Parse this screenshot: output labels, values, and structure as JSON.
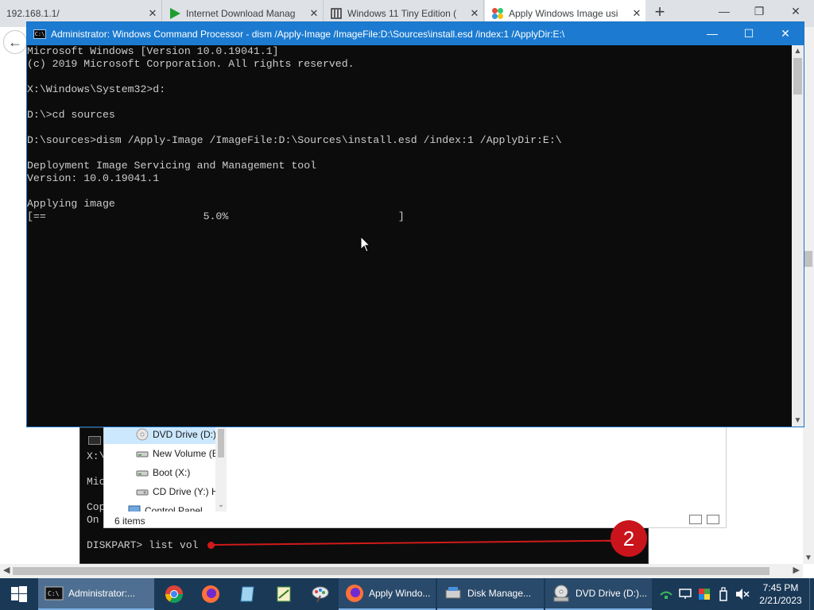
{
  "browser": {
    "tabs": [
      {
        "title": "192.168.1.1/",
        "icon": "blank-page-icon",
        "close": "✕"
      },
      {
        "title": "Internet Download Manag",
        "icon": "idm-play-icon",
        "close": "✕"
      },
      {
        "title": "Windows 11 Tiny Edition (",
        "icon": "archive-icon",
        "close": "✕"
      },
      {
        "title": "Apply Windows Image usi",
        "icon": "windows-logo-icon",
        "close": "✕"
      }
    ],
    "new_tab": "+",
    "window_controls": {
      "minimize": "—",
      "restore": "❐",
      "close": "✕"
    },
    "back": "←"
  },
  "cmd_window": {
    "title": "Administrator: Windows Command Processor - dism  /Apply-Image /ImageFile:D:\\Sources\\install.esd /index:1 /ApplyDir:E:\\",
    "controls": {
      "minimize": "—",
      "maximize": "☐",
      "close": "✕"
    },
    "lines": [
      "Microsoft Windows [Version 10.0.19041.1]",
      "(c) 2019 Microsoft Corporation. All rights reserved.",
      "",
      "X:\\Windows\\System32>d:",
      "",
      "D:\\>cd sources",
      "",
      "D:\\sources>dism /Apply-Image /ImageFile:D:\\Sources\\install.esd /index:1 /ApplyDir:E:\\",
      "",
      "Deployment Image Servicing and Management tool",
      "Version: 10.0.19041.1",
      "",
      "Applying image",
      "[==                         5.0%                           ]"
    ],
    "progress_percent": 5.0
  },
  "background": {
    "console_lines": [
      "X:\\",
      "Mic",
      "Cop",
      "On"
    ],
    "diskpart_prompt": "DISKPART> list vol",
    "annotation_number": "2",
    "explorer": {
      "nav_items": [
        {
          "label": "DVD Drive (D:)",
          "icon": "dvd-drive-icon",
          "selected": true
        },
        {
          "label": "New Volume (E",
          "icon": "drive-icon",
          "selected": false
        },
        {
          "label": "Boot (X:)",
          "icon": "drive-icon",
          "selected": false
        },
        {
          "label": "CD Drive (Y:) H",
          "icon": "cd-drive-icon",
          "selected": false
        },
        {
          "label": "Control Panel",
          "icon": "control-panel-icon",
          "selected": false
        }
      ],
      "status": "6 items"
    }
  },
  "taskbar": {
    "items": [
      {
        "label": "Administrator:...",
        "icon": "cmd-icon",
        "active": true
      },
      {
        "label": "Apply Windo...",
        "icon": "firefox-icon",
        "active": false
      },
      {
        "label": "Disk Manage...",
        "icon": "disk-management-icon",
        "active": false
      },
      {
        "label": "DVD Drive (D:)...",
        "icon": "dvd-drive-icon",
        "active": false
      }
    ],
    "pinned": [
      "chrome-icon",
      "firefox-icon",
      "notepad-icon",
      "spreadsheet-icon",
      "paint-icon"
    ],
    "clock": {
      "time": "7:45 PM",
      "date": "2/21/2023"
    }
  },
  "colors": {
    "cmd_titlebar": "#1c7bd0",
    "cmd_background": "#0c0c0c",
    "cmd_text": "#cccccc",
    "taskbar": "#1a3957",
    "annotation_red": "#c8141a"
  }
}
